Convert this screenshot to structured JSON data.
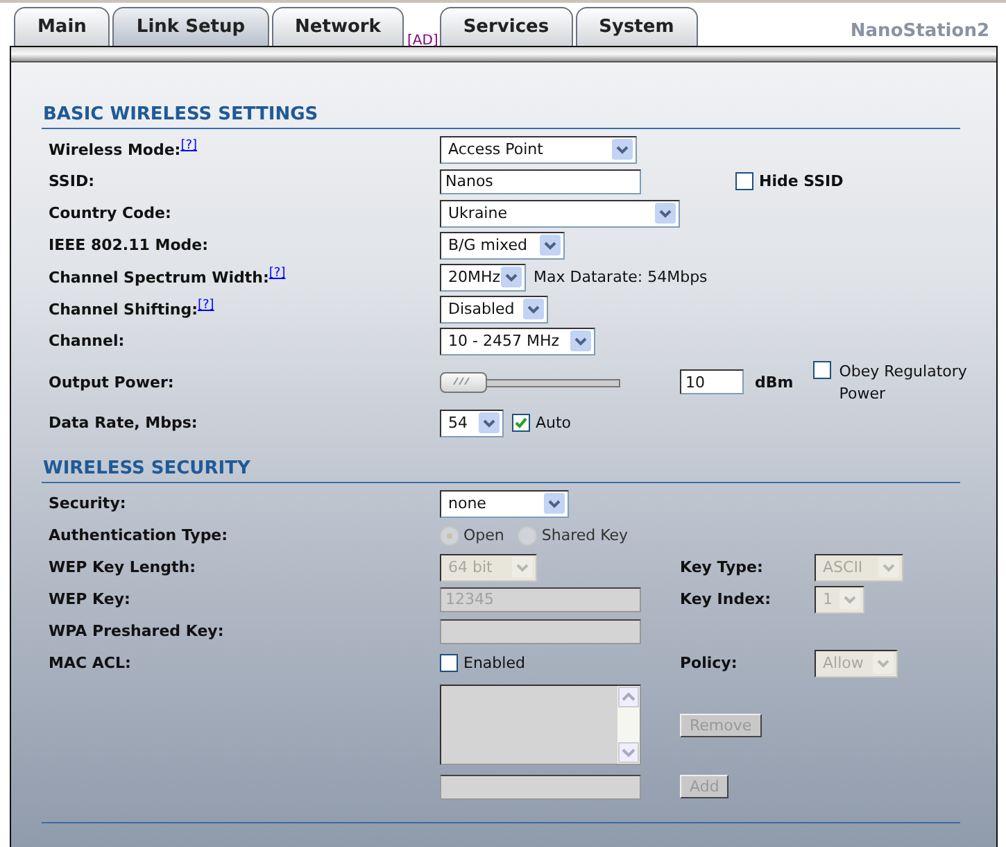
{
  "tabs": [
    {
      "label": "Main",
      "selected": false
    },
    {
      "label": "Link Setup",
      "selected": true
    },
    {
      "label": "Network",
      "selected": false
    },
    {
      "label": "Services",
      "selected": false
    },
    {
      "label": "System",
      "selected": false
    }
  ],
  "ad_link": "[AD]",
  "brand": "NanoStation2",
  "sections": [
    {
      "title": "BASIC WIRELESS SETTINGS",
      "rows": [
        {
          "label": "Wireless Mode:",
          "help": "[?]",
          "controls": [
            {
              "kind": "select",
              "value": "Access Point",
              "disabled": false
            }
          ],
          "side": []
        },
        {
          "label": "SSID:",
          "controls": [
            {
              "kind": "text",
              "value": "Nanos",
              "disabled": false
            }
          ],
          "side": [
            {
              "kind": "checkbox",
              "label": "Hide SSID",
              "checked": false,
              "bold": true
            }
          ]
        },
        {
          "label": "Country Code:",
          "controls": [
            {
              "kind": "select",
              "value": "Ukraine",
              "disabled": false
            }
          ],
          "side": []
        },
        {
          "label": "IEEE 802.11 Mode:",
          "controls": [
            {
              "kind": "select",
              "value": "B/G mixed",
              "disabled": false
            }
          ],
          "side": []
        },
        {
          "label": "Channel Spectrum Width:",
          "help": "[?]",
          "controls": [
            {
              "kind": "select",
              "value": "20MHz",
              "disabled": false
            },
            {
              "kind": "note",
              "text": "Max Datarate: 54Mbps"
            }
          ],
          "side": []
        },
        {
          "label": "Channel Shifting:",
          "help": "[?]",
          "controls": [
            {
              "kind": "select",
              "value": "Disabled",
              "disabled": false
            }
          ],
          "side": []
        },
        {
          "label": "Channel:",
          "controls": [
            {
              "kind": "select",
              "value": "10 - 2457 MHz",
              "disabled": false
            }
          ],
          "side": []
        },
        {
          "label": "Output Power:",
          "controls": [
            {
              "kind": "slider",
              "level": 0
            }
          ],
          "side": [
            {
              "kind": "text",
              "value": "10",
              "disabled": false
            },
            {
              "kind": "unit",
              "text": "dBm"
            },
            {
              "kind": "checkbox",
              "label": "Obey Regulatory Power",
              "checked": false,
              "bold": false
            }
          ]
        },
        {
          "label": "Data Rate, Mbps:",
          "controls": [
            {
              "kind": "select",
              "value": "54",
              "disabled": false
            },
            {
              "kind": "checkbox",
              "label": "Auto",
              "checked": true,
              "bold": false
            }
          ],
          "side": []
        }
      ]
    },
    {
      "title": "WIRELESS SECURITY",
      "rows": [
        {
          "label": "Security:",
          "controls": [
            {
              "kind": "select",
              "value": "none",
              "disabled": false
            }
          ],
          "side": []
        },
        {
          "label": "Authentication Type:",
          "controls": [
            {
              "kind": "radio",
              "label": "Open",
              "selected": true,
              "disabled": true
            },
            {
              "kind": "radio",
              "label": "Shared Key",
              "selected": false,
              "disabled": true
            }
          ],
          "side": []
        },
        {
          "label": "WEP Key Length:",
          "controls": [
            {
              "kind": "select",
              "value": "64 bit",
              "disabled": true
            }
          ],
          "side": [
            {
              "kind": "label",
              "text": "Key Type:"
            },
            {
              "kind": "select",
              "value": "ASCII",
              "disabled": true
            }
          ]
        },
        {
          "label": "WEP Key:",
          "controls": [
            {
              "kind": "text",
              "value": "12345",
              "disabled": true
            }
          ],
          "side": [
            {
              "kind": "label",
              "text": "Key Index:"
            },
            {
              "kind": "select",
              "value": "1",
              "disabled": true
            }
          ]
        },
        {
          "label": "WPA Preshared Key:",
          "controls": [
            {
              "kind": "text",
              "disabled": true
            }
          ],
          "side": []
        },
        {
          "label": "MAC ACL:",
          "controls": [
            {
              "kind": "checkbox",
              "label": "Enabled",
              "checked": false,
              "bold": false
            }
          ],
          "side": [
            {
              "kind": "label",
              "text": "Policy:"
            },
            {
              "kind": "select",
              "value": "Allow",
              "disabled": true
            }
          ]
        },
        {
          "controls": [
            {
              "kind": "textarea",
              "disabled": true
            }
          ],
          "side": [
            {
              "kind": "button",
              "text": "Remove",
              "disabled": true
            }
          ]
        },
        {
          "controls": [
            {
              "kind": "text",
              "disabled": true
            }
          ],
          "side": [
            {
              "kind": "button",
              "text": "Add",
              "disabled": true
            }
          ]
        }
      ]
    }
  ]
}
